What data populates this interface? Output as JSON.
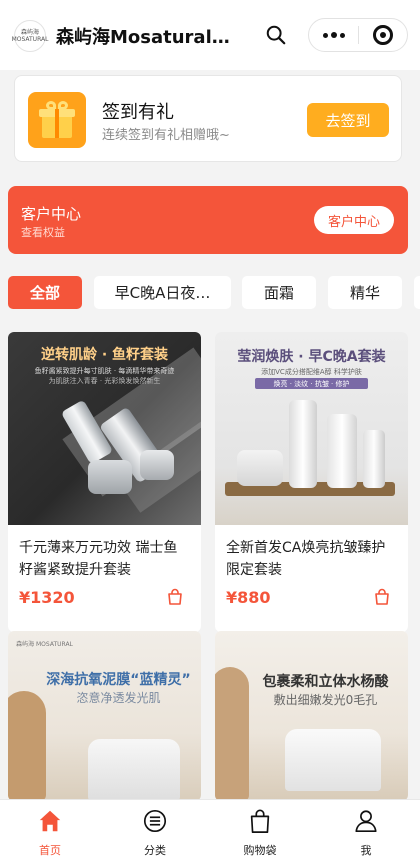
{
  "header": {
    "logo_text": "森屿海 MOSATURAL",
    "title": "森屿海Mosatural…"
  },
  "signin": {
    "title": "签到有礼",
    "subtitle": "连续签到有礼相赠哦~",
    "button": "去签到"
  },
  "customer_center": {
    "title": "客户中心",
    "subtitle": "查看权益",
    "button": "客户中心"
  },
  "tabs": [
    {
      "label": "全部",
      "active": true
    },
    {
      "label": "早C晚A日夜…",
      "active": false
    },
    {
      "label": "面霜",
      "active": false
    },
    {
      "label": "精华",
      "active": false
    }
  ],
  "products": [
    {
      "name": "千元薄来万元功效 瑞士鱼籽酱紧致提升套装",
      "price": "¥1320",
      "image": {
        "headline": "逆转肌龄 · 鱼籽套装",
        "line1": "鱼籽酱紧致提升每寸肌肤 · 每滴精华带来奇迹",
        "line2": "为肌肤注入青春 · 光彩焕发焕然新生"
      }
    },
    {
      "name": "全新首发CA焕亮抗皱臻护 限定套装",
      "price": "¥880",
      "image": {
        "headline": "莹润焕肤 · 早C晚A套装",
        "line1": "添加VC成分搭配维A醇 科学护肤",
        "line2": "焕亮 · 淡纹 · 抗皱 · 修护"
      }
    },
    {
      "image": {
        "brand": "森屿海 MOSATURAL",
        "headline": "深海抗氧泥膜“蓝精灵”",
        "line1": "恣意净透发光肌"
      }
    },
    {
      "image": {
        "headline": "包裹柔和立体水杨酸",
        "line1": "敷出细嫩发光0毛孔"
      }
    }
  ],
  "nav": [
    {
      "label": "首页",
      "icon": "home-icon",
      "active": true
    },
    {
      "label": "分类",
      "icon": "category-icon",
      "active": false
    },
    {
      "label": "购物袋",
      "icon": "shopping-bag-icon",
      "active": false
    },
    {
      "label": "我",
      "icon": "user-icon",
      "active": false
    }
  ],
  "colors": {
    "accent": "#f4553a",
    "signin_button": "#ffad1f"
  }
}
